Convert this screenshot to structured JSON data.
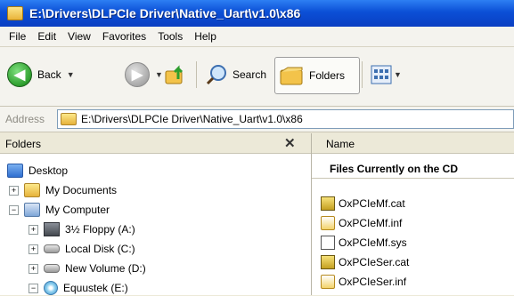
{
  "window": {
    "title": "E:\\Drivers\\DLPCIe Driver\\Native_Uart\\v1.0\\x86"
  },
  "menu": [
    "File",
    "Edit",
    "View",
    "Favorites",
    "Tools",
    "Help"
  ],
  "toolbar": {
    "back_label": "Back",
    "search_label": "Search",
    "folders_label": "Folders"
  },
  "address": {
    "label": "Address",
    "value": "E:\\Drivers\\DLPCIe Driver\\Native_Uart\\v1.0\\x86"
  },
  "folders_pane": {
    "title": "Folders",
    "close_glyph": "✕",
    "tree": [
      {
        "label": "Desktop"
      },
      {
        "label": "My Documents"
      },
      {
        "label": "My Computer"
      },
      {
        "label": "3½ Floppy (A:)"
      },
      {
        "label": "Local Disk (C:)"
      },
      {
        "label": "New Volume (D:)"
      },
      {
        "label": "Equustek (E:)"
      }
    ]
  },
  "files_pane": {
    "column_name": "Name",
    "group_heading": "Files Currently on the CD",
    "files": [
      "OxPCIeMf.cat",
      "OxPCIeMf.inf",
      "OxPCIeMf.sys",
      "OxPCIeSer.cat",
      "OxPCIeSer.inf"
    ]
  }
}
